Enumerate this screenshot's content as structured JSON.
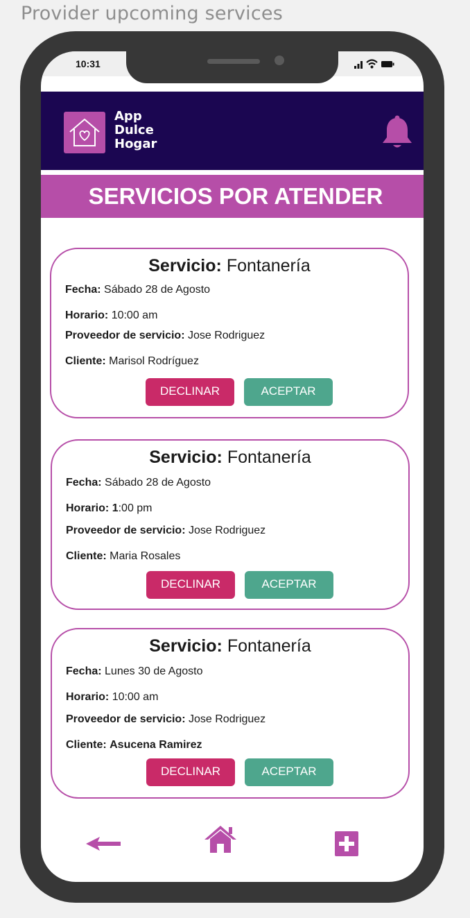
{
  "caption": "Provider upcoming services",
  "status_bar": {
    "time": "10:31"
  },
  "app": {
    "logo_line1": "App",
    "logo_line2": "Dulce",
    "logo_line3": "Hogar"
  },
  "page_title": "SERVICIOS POR ATENDER",
  "labels": {
    "servicio": "Servicio:",
    "fecha": "Fecha:",
    "horario": "Horario:",
    "proveedor": "Proveedor de servicio:",
    "cliente": "Cliente:"
  },
  "services": [
    {
      "servicio": "Fontanería",
      "fecha": "Sábado 28 de Agosto",
      "horario": "10:00 am",
      "proveedor": "Jose Rodriguez",
      "cliente": "Marisol Rodríguez",
      "decline_label": "DECLINAR",
      "accept_label": "ACEPTAR"
    },
    {
      "servicio": "Fontanería",
      "fecha": "Sábado 28 de Agosto",
      "horario_bold": "1",
      "horario_rest": ":00 pm",
      "proveedor": "Jose Rodriguez",
      "cliente": "Maria Rosales",
      "decline_label": "DECLINAR",
      "accept_label": "ACEPTAR"
    },
    {
      "servicio": "Fontanería",
      "fecha": "Lunes 30 de Agosto",
      "horario": "10:00 am",
      "proveedor": "Jose Rodriguez",
      "cliente": "Asucena Ramirez",
      "decline_label": "DECLINAR",
      "accept_label": "ACEPTAR"
    }
  ],
  "icons": {
    "back": "arrow-left-icon",
    "home": "home-icon",
    "add": "plus-square-icon",
    "bell": "bell-icon",
    "logo": "house-heart-icon"
  },
  "colors": {
    "navy": "#1b0651",
    "magenta": "#b64ea8",
    "decline": "#c92a68",
    "accept": "#4ea68d"
  }
}
